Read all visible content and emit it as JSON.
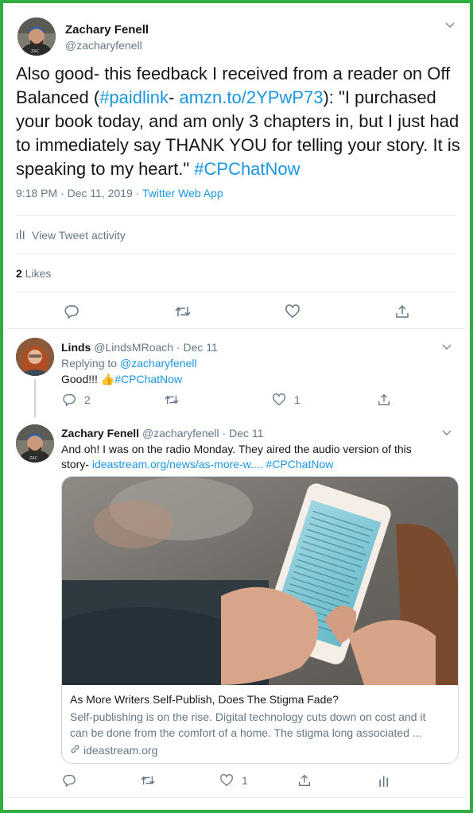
{
  "main_tweet": {
    "author_name": "Zachary Fenell",
    "author_handle": "@zacharyfenell",
    "text_1": "Also good- this feedback I received from a reader on Off Balanced (",
    "hashtag_paidlink": "#paidlink",
    "text_2": "- ",
    "link_amzn": "amzn.to/2YPwP73",
    "text_3": "): \"I purchased your book today, and am only 3 chapters in, but I just had to immediately say THANK YOU for telling your story. It is speaking to my heart.\" ",
    "hashtag_cp": "#CPChatNow",
    "timestamp": "9:18 PM · Dec 11, 2019 · ",
    "source": "Twitter Web App",
    "activity_label": "View Tweet activity",
    "likes_count": "2",
    "likes_label": " Likes"
  },
  "reply_1": {
    "author_name": "Linds",
    "author_handle": "@LindsMRoach",
    "date": " · Dec 11",
    "replying_to_label": "Replying to ",
    "replying_to_handle": "@zacharyfenell",
    "text": "Good!!! ",
    "emoji": "👍",
    "hashtag": "#CPChatNow",
    "reply_count": "2",
    "like_count": "1"
  },
  "reply_2": {
    "author_name": "Zachary Fenell",
    "author_handle": "@zacharyfenell",
    "date": " · Dec 11",
    "text_line1": "And oh! I was on the radio Monday. They aired the audio version of this",
    "text_line2_prefix": "story- ",
    "link": "ideastream.org/news/as-more-w....",
    "hashtag": "#CPChatNow",
    "like_count": "1",
    "card": {
      "title": "As More Writers Self-Publish, Does The Stigma Fade?",
      "description_line1": "Self-publishing is on the rise. Digital technology cuts down on cost and it",
      "description_line2": "can be done from the comfort of a home.   The stigma long associated ...",
      "domain": "ideastream.org"
    }
  },
  "colors": {
    "frame_border": "#2fae3f",
    "link": "#1b95e0",
    "muted": "#657786",
    "divider": "#e6ecf0"
  },
  "icons": [
    "chevron-down-icon",
    "reply-icon",
    "retweet-icon",
    "like-icon",
    "share-icon",
    "analytics-icon",
    "link-icon"
  ]
}
